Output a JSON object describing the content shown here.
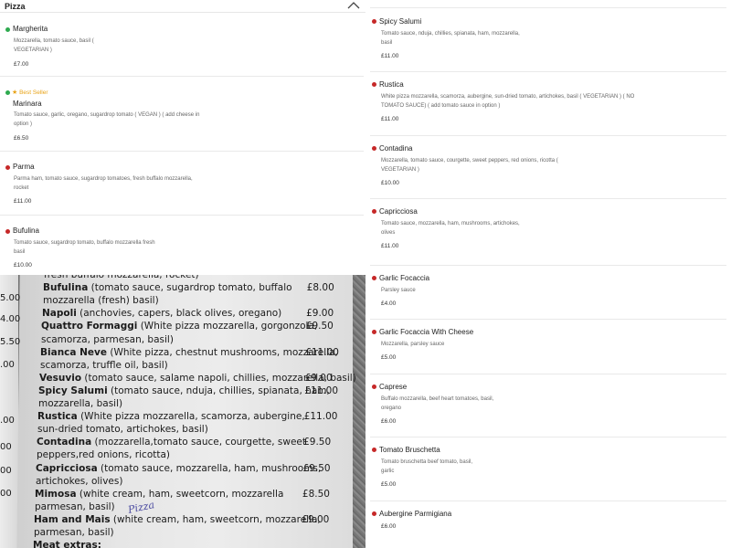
{
  "section": {
    "title": "Pizza",
    "collapse_icon": "chevron-up-icon"
  },
  "left_items": [
    {
      "name": "Margherita",
      "diet": "veg",
      "badge": "",
      "desc_lines": [
        "Mozzarella, tomato sauce, basil (",
        "VEGETARIAN )"
      ],
      "price": "£7.00"
    },
    {
      "name": "Marinara",
      "diet": "veg",
      "badge": "Best Seller",
      "desc_lines": [
        "Tomato sauce, garlic, oregano, sugardrop tomato ( VEGAN ) ( add cheese in",
        "option )"
      ],
      "price": "£6.50"
    },
    {
      "name": "Parma",
      "diet": "meat",
      "badge": "",
      "desc_lines": [
        "Parma ham, tomato sauce, sugardrop tomatoes, fresh buffalo mozzarella,",
        "rocket"
      ],
      "price": "£11.00"
    },
    {
      "name": "Bufulina",
      "diet": "meat",
      "badge": "",
      "desc_lines": [
        "Tomato sauce, sugardrop tomato, buffalo mozzarella fresh",
        "basil"
      ],
      "price": "£10.00"
    }
  ],
  "right_items": [
    {
      "name": "Spicy Salumi",
      "desc_lines": [
        "Tomato sauce, nduja, chillies, spianata, ham, mozzarella,",
        "basil"
      ],
      "price": "£11.00"
    },
    {
      "name": "Rustica",
      "desc_lines": [
        "White pizza mozzarella, scamorza, aubergine, sun-dried tomato, artichokes, basil ( VEGETARIAN ) ( NO",
        "TOMATO SAUCE) ( add tomato sauce in option )"
      ],
      "price": "£11.00"
    },
    {
      "name": "Contadina",
      "desc_lines": [
        "Mozzarella, tomato sauce, courgette, sweet peppers, red onions, ricotta (",
        "VEGETARIAN )"
      ],
      "price": "£10.00"
    },
    {
      "name": "Capricciosa",
      "desc_lines": [
        "Tomato sauce, mozzarella, ham, mushrooms, artichokes,",
        "olives"
      ],
      "price": "£11.00"
    },
    {
      "name": "Garlic Focaccia",
      "desc_lines": [
        "Parsley sauce"
      ],
      "price": "£4.00"
    },
    {
      "name": "Garlic Focaccia With Cheese",
      "desc_lines": [
        "Mozzarella, parsley sauce"
      ],
      "price": "£5.00"
    },
    {
      "name": "Caprese",
      "desc_lines": [
        "Buffalo mozzarella, beef heart tomatoes, basil,",
        "oregano"
      ],
      "price": "£6.00"
    },
    {
      "name": "Tomato Bruschetta",
      "desc_lines": [
        "Tomato bruschetta beef tomato, basil,",
        "garlic"
      ],
      "price": "£5.00"
    },
    {
      "name": "Aubergine Parmigiana",
      "desc_lines": [],
      "price": "£6.00"
    }
  ],
  "photo_menu": {
    "edge_prices": [
      "5.00",
      "4.00",
      "5.50",
      ".00",
      ".00",
      "00",
      "00",
      "00"
    ],
    "lines": [
      {
        "name": "",
        "rest": "fresh buffalo mozzarella, rocket)",
        "price": ""
      },
      {
        "name": "Bufulina",
        "rest": " (tomato sauce, sugardrop tomato, buffalo",
        "price": "£8.00"
      },
      {
        "name": "",
        "rest": "mozzarella (fresh) basil)",
        "price": ""
      },
      {
        "name": "Napoli",
        "rest": " (anchovies, capers, black olives, oregano)",
        "price": "£9.00"
      },
      {
        "name": "Quattro Formaggi",
        "rest": " (White pizza mozzarella, gorgonzola,",
        "price": "£9.50"
      },
      {
        "name": "",
        "rest": "scamorza, parmesan, basil)",
        "price": ""
      },
      {
        "name": "Bianca Neve",
        "rest": " (White pizza, chestnut mushrooms, mozzarella,",
        "price": "£11.00"
      },
      {
        "name": "",
        "rest": "scamorza, truffle oil, basil)",
        "price": ""
      },
      {
        "name": "Vesuvio",
        "rest": " (tomato sauce, salame napoli, chillies, mozzarella, basil)",
        "price": "£9.00"
      },
      {
        "name": "Spicy Salumi",
        "rest": " (tomato sauce, nduja, chillies, spianata, ham,",
        "price": "£11.00"
      },
      {
        "name": "",
        "rest": "mozzarella, basil)",
        "price": ""
      },
      {
        "name": "Rustica",
        "rest": " (White pizza mozzarella, scamorza, aubergine,",
        "price": "£11.00"
      },
      {
        "name": "",
        "rest": "sun-dried tomato, artichokes, basil)",
        "price": ""
      },
      {
        "name": "Contadina",
        "rest": " (mozzarella,tomato sauce, courgette, sweet",
        "price": "£9.50"
      },
      {
        "name": "",
        "rest": "peppers,red onions, ricotta)",
        "price": ""
      },
      {
        "name": "Capricciosa",
        "rest": " (tomato sauce, mozzarella, ham, mushrooms,",
        "price": "£9.50"
      },
      {
        "name": "",
        "rest": "artichokes, olives)",
        "price": ""
      },
      {
        "name": "Mimosa",
        "rest": " (white cream, ham, sweetcorn, mozzarella",
        "price": "£8.50"
      },
      {
        "name": "",
        "rest": "parmesan, basil)",
        "price": ""
      },
      {
        "name": "Ham and Mais",
        "rest": " (white cream, ham, sweetcorn, mozzarella,",
        "price": "£9.00"
      },
      {
        "name": "",
        "rest": "parmesan, basil)",
        "price": ""
      },
      {
        "name": "Meat extras:",
        "rest": "",
        "price": ""
      }
    ],
    "handwriting": "Pizza"
  }
}
